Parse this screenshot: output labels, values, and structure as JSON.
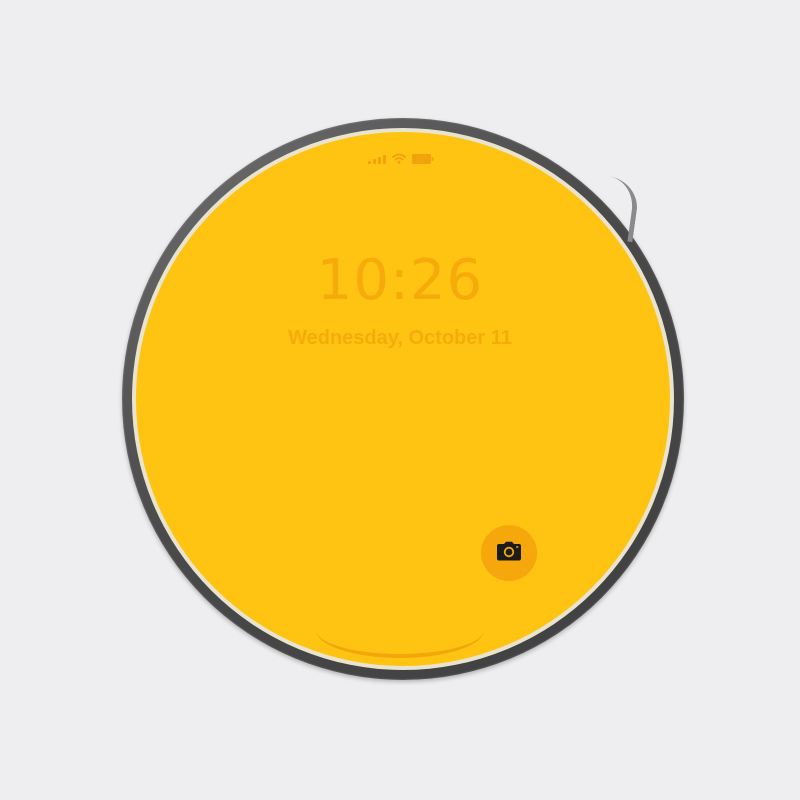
{
  "lock_screen": {
    "time": "10:26",
    "date": "Wednesday, October 11"
  },
  "status_bar": {
    "icons": [
      "cellular-signal-icon",
      "wifi-icon",
      "battery-icon"
    ]
  },
  "quick_actions": {
    "camera_icon": "camera-icon"
  },
  "colors": {
    "screen_background": "#ffc412",
    "text_accent": "#f6ab0b",
    "camera_button": "#f5a70c",
    "bezel": "#4a4a4a",
    "page_background": "#eeeef0"
  }
}
